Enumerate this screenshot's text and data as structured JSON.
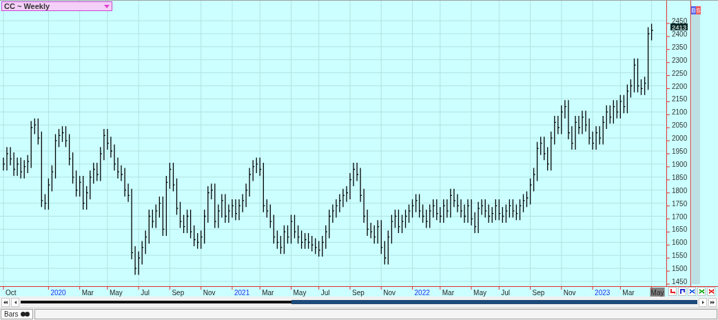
{
  "chart_title": "CC ~ Weekly",
  "last_price": "2413",
  "side_buttons": [
    {
      "label": "B",
      "color": "#5b6cf0"
    },
    {
      "label": "S",
      "color": "#f06060"
    }
  ],
  "price_scale": [
    "2450",
    "2400",
    "2350",
    "2300",
    "2250",
    "2200",
    "2150",
    "2100",
    "2050",
    "2000",
    "1950",
    "1900",
    "1850",
    "1800",
    "1750",
    "1700",
    "1650",
    "1600",
    "1550",
    "1500",
    "1450"
  ],
  "date_axis": [
    {
      "label": "Oct",
      "kind": "month"
    },
    {
      "label": "2020",
      "kind": "year"
    },
    {
      "label": "Mar",
      "kind": "month"
    },
    {
      "label": "May",
      "kind": "month"
    },
    {
      "label": "Jul",
      "kind": "month"
    },
    {
      "label": "Sep",
      "kind": "month"
    },
    {
      "label": "Nov",
      "kind": "month"
    },
    {
      "label": "2021",
      "kind": "year"
    },
    {
      "label": "Mar",
      "kind": "month"
    },
    {
      "label": "May",
      "kind": "month"
    },
    {
      "label": "Jul",
      "kind": "month"
    },
    {
      "label": "Sep",
      "kind": "month"
    },
    {
      "label": "Nov",
      "kind": "month"
    },
    {
      "label": "2022",
      "kind": "year"
    },
    {
      "label": "Mar",
      "kind": "month"
    },
    {
      "label": "May",
      "kind": "month"
    },
    {
      "label": "Jul",
      "kind": "month"
    },
    {
      "label": "Sep",
      "kind": "month"
    },
    {
      "label": "Nov",
      "kind": "month"
    },
    {
      "label": "2023",
      "kind": "year"
    },
    {
      "label": "Mar",
      "kind": "month"
    },
    {
      "label": "May",
      "kind": "current"
    }
  ],
  "tools": [
    {
      "kind": "step-down",
      "color": "#e02020"
    },
    {
      "kind": "step-up",
      "color": "#2030d0"
    },
    {
      "kind": "cross",
      "color": "#2060e0"
    },
    {
      "kind": "cross",
      "color": "#20b020"
    },
    {
      "kind": "cross",
      "color": "#e02020"
    }
  ],
  "scroll": {
    "level": 0.6
  },
  "bottom_tab": {
    "label": "Bars"
  }
}
